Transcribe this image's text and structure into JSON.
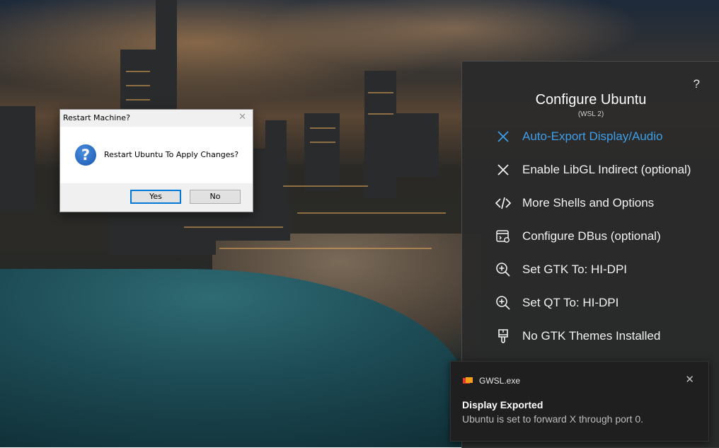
{
  "dialog": {
    "title": "Restart Machine?",
    "close_glyph": "✕",
    "question_glyph": "?",
    "message": "Restart Ubuntu To Apply Changes?",
    "yes_label": "Yes",
    "no_label": "No"
  },
  "panel": {
    "help_label": "?",
    "title": "Configure Ubuntu",
    "subtitle": "(WSL 2)",
    "accent_color": "#3e9ee8",
    "items": [
      {
        "label": "Auto-Export Display/Audio",
        "icon": "close-icon",
        "active": true
      },
      {
        "label": "Enable LibGL Indirect (optional)",
        "icon": "close-icon",
        "active": false
      },
      {
        "label": "More Shells and Options",
        "icon": "code-icon",
        "active": false
      },
      {
        "label": "Configure DBus (optional)",
        "icon": "settings-script-icon",
        "active": false
      },
      {
        "label": "Set GTK To: HI-DPI",
        "icon": "zoom-in-icon",
        "active": false
      },
      {
        "label": "Set QT To: HI-DPI",
        "icon": "zoom-in-icon",
        "active": false
      },
      {
        "label": "No GTK Themes Installed",
        "icon": "paint-brush-icon",
        "active": false
      }
    ]
  },
  "toast": {
    "app_name": "GWSL.exe",
    "close_glyph": "✕",
    "title": "Display Exported",
    "body": "Ubuntu is set to forward X through port 0."
  }
}
